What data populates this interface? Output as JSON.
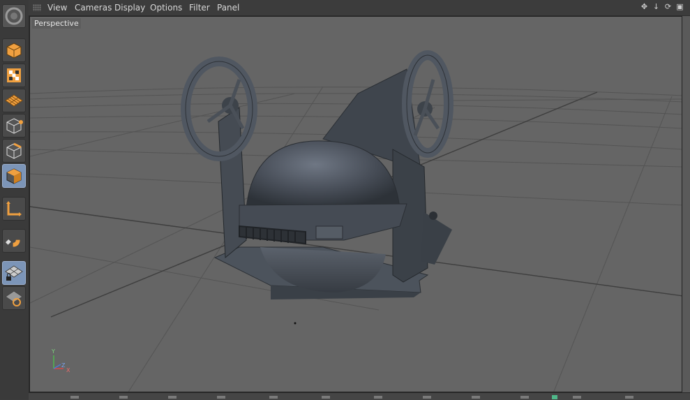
{
  "menu": {
    "view": "View",
    "cameras": "Cameras",
    "display": "Display",
    "options": "Options",
    "filter": "Filter",
    "panel": "Panel"
  },
  "viewport": {
    "label": "Perspective"
  },
  "axis": {
    "y": "Y",
    "z": "Z",
    "x": "X"
  },
  "toolbar_icons": [
    "logo-icon",
    "model-mode-icon",
    "texture-mode-icon",
    "workplane-mode-icon",
    "points-mode-icon",
    "edges-mode-icon",
    "polygons-mode-icon",
    "axis-mode-icon",
    "snap-magnet-icon",
    "locked-workplane-icon",
    "planar-workplane-icon"
  ],
  "colors": {
    "accent": "#f0a040",
    "active_tool": "#7c95b8",
    "viewport_bg": "#656565"
  }
}
